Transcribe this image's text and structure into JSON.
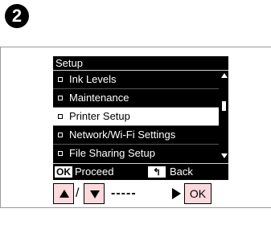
{
  "step": {
    "number": "2"
  },
  "screen": {
    "title": "Setup",
    "items": [
      {
        "label": "Ink Levels",
        "selected": false
      },
      {
        "label": "Maintenance",
        "selected": false
      },
      {
        "label": "Printer Setup",
        "selected": true
      },
      {
        "label": "Network/Wi-Fi Settings",
        "selected": false
      },
      {
        "label": "File Sharing Setup",
        "selected": false
      }
    ],
    "footer": {
      "ok_key": "OK",
      "proceed": "Proceed",
      "back_key": "↰",
      "back": "Back"
    }
  },
  "keys": {
    "slash": "/",
    "dashes": "-----",
    "ok_label": "OK"
  },
  "colors": {
    "key_fill": "#fbd9dd",
    "screen_bg": "#000000",
    "selected_bg": "#ffffff"
  },
  "icons": {
    "up": "triangle-up-icon",
    "down": "triangle-down-icon",
    "arrow": "arrow-right-icon",
    "back": "return-icon"
  }
}
